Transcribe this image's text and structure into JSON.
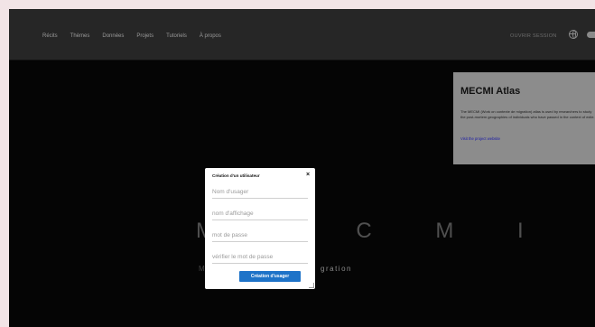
{
  "nav": {
    "links": [
      "Récits",
      "Thèmes",
      "Données",
      "Projets",
      "Tutoriels",
      "À propos"
    ],
    "session_label": "OUVRIR SESSION"
  },
  "info_panel": {
    "title": "MECMI Atlas",
    "text": "The MECMI (Work on contexte de migration) atlas is used by researchers to study the post-mortem geographies of individuals who have passed in the context of exile.",
    "link": "Visit the project website"
  },
  "background": {
    "logo_text": "M E C M I",
    "subtitle": "gration",
    "subtitle_prefix": "M"
  },
  "modal": {
    "title": "Création d'un utilisateur",
    "close_label": "×",
    "fields": {
      "username_placeholder": "Nom d'usager",
      "displayname_placeholder": "nom d'affichage",
      "password_placeholder": "mot de passe",
      "password_confirm_placeholder": "vérifier le mot de passe"
    },
    "submit_label": "Création d'usager"
  },
  "colors": {
    "page_bg": "#f2e4e6",
    "screen_bg": "#050505",
    "navbar_bg": "#262626",
    "panel_bg": "#8c8c8c",
    "button_bg": "#1e73c8"
  }
}
